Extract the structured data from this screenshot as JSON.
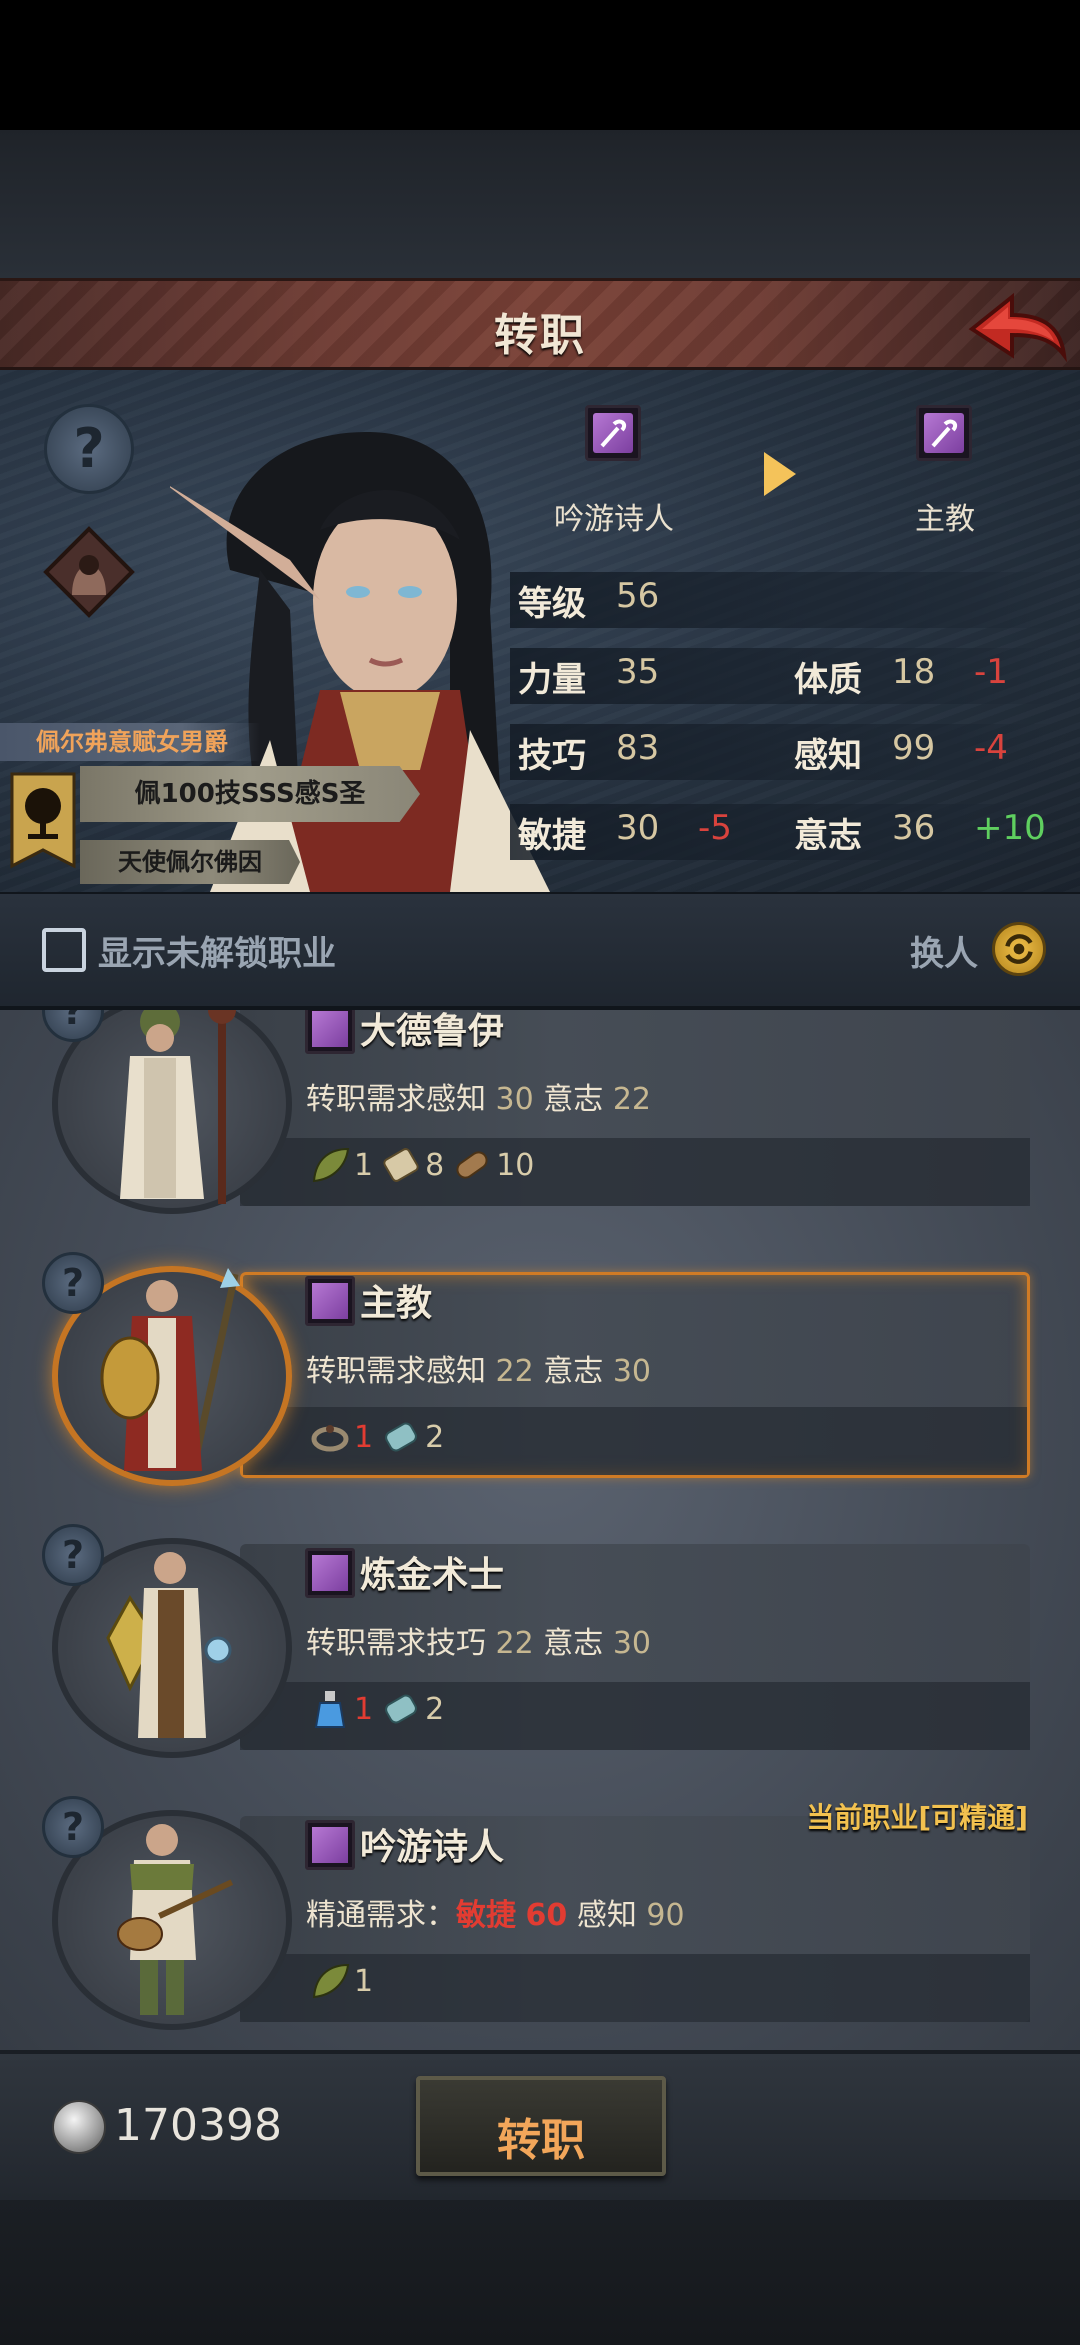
{
  "header": {
    "title": "转职"
  },
  "character": {
    "noble_title": "佩尔弗意赋女男爵",
    "title_line1": "佩100技SSS感S圣",
    "title_line2": "天使佩尔佛因"
  },
  "class_change": {
    "from": "吟游诗人",
    "to": "主教"
  },
  "stats": {
    "level_label": "等级",
    "level_value": "56",
    "str_label": "力量",
    "str_value": "35",
    "con_label": "体质",
    "con_value": "18",
    "con_delta": "-1",
    "skill_label": "技巧",
    "skill_value": "83",
    "per_label": "感知",
    "per_value": "99",
    "per_delta": "-4",
    "agi_label": "敏捷",
    "agi_value": "30",
    "agi_delta": "-5",
    "will_label": "意志",
    "will_value": "36",
    "will_delta": "+10"
  },
  "filter": {
    "show_locked_label": "显示未解锁职业",
    "swap_label": "换人"
  },
  "classes": [
    {
      "name": "大德鲁伊",
      "req_prefix": "转职需求",
      "req_stat1": "感知",
      "req_val1": "30",
      "req_stat2": "意志",
      "req_val2": "22",
      "items": [
        "1",
        "8",
        "10"
      ]
    },
    {
      "name": "主教",
      "req_prefix": "转职需求",
      "req_stat1": "感知",
      "req_val1": "22",
      "req_stat2": "意志",
      "req_val2": "30",
      "items": [
        "1",
        "2"
      ]
    },
    {
      "name": "炼金术士",
      "req_prefix": "转职需求",
      "req_stat1": "技巧",
      "req_val1": "22",
      "req_stat2": "意志",
      "req_val2": "30",
      "items": [
        "1",
        "2"
      ]
    },
    {
      "name": "吟游诗人",
      "tag": "当前职业[可精通]",
      "req_prefix": "精通需求：",
      "req_stat1": "敏捷",
      "req_val1": "60",
      "req_stat2": "感知",
      "req_val2": "90",
      "items": [
        "1"
      ]
    }
  ],
  "footer": {
    "currency": "170398",
    "confirm_label": "转职"
  },
  "help_glyph": "?"
}
